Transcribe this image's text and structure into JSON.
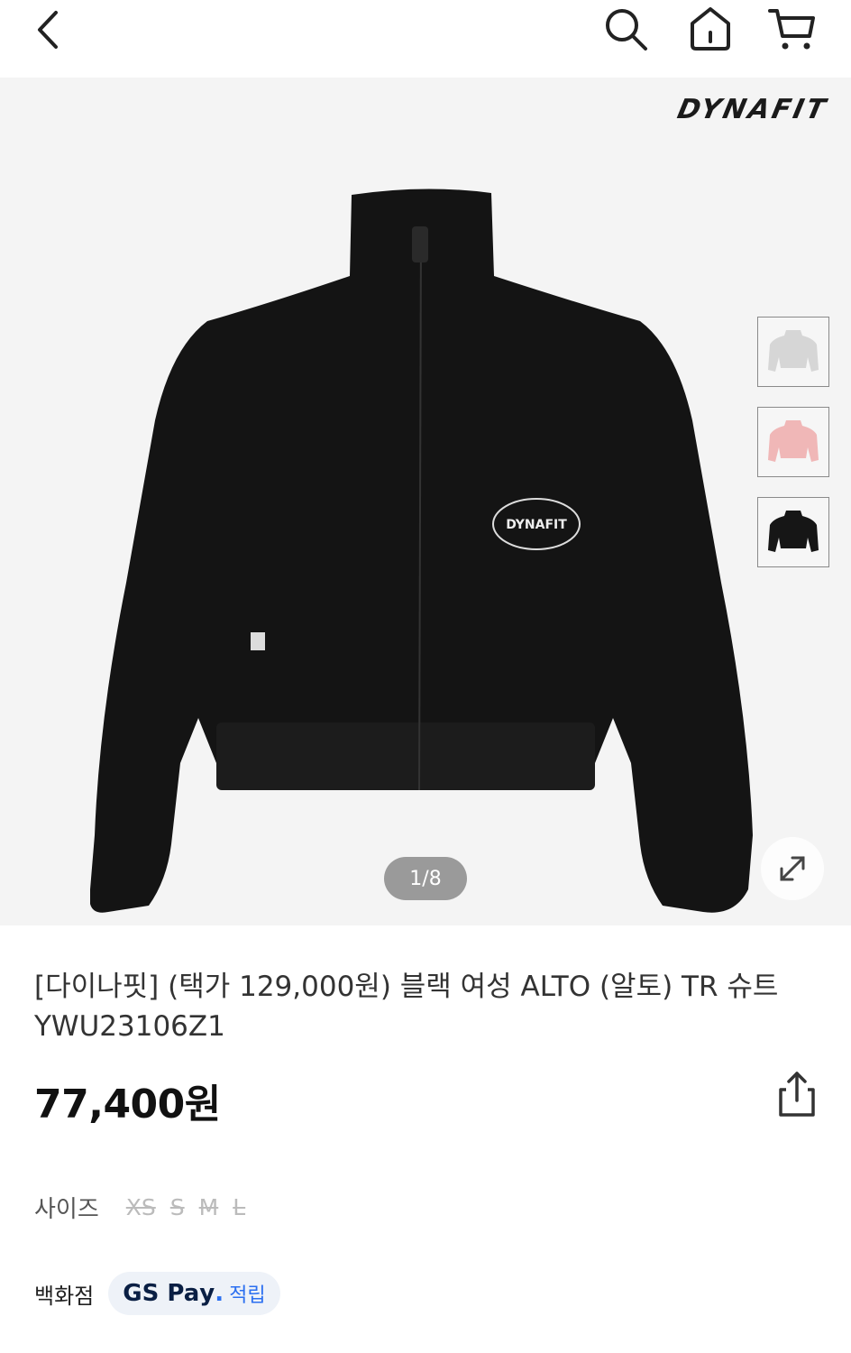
{
  "header": {
    "back_icon": "chevron-left-icon",
    "search_icon": "search-icon",
    "home_icon": "home-icon",
    "cart_icon": "cart-icon"
  },
  "gallery": {
    "brand_logo": "DYNAFIT",
    "pager": "1/8",
    "thumbnails": [
      {
        "color": "light-gray"
      },
      {
        "color": "pink"
      },
      {
        "color": "black"
      }
    ]
  },
  "product": {
    "title": "[다이나핏] (택가 129,000원) 블랙 여성 ALTO (알토) TR 슈트 YWU23106Z1",
    "price": "77,400원"
  },
  "sizes": {
    "label": "사이즈",
    "options": [
      "XS",
      "S",
      "M",
      "L"
    ]
  },
  "department": {
    "label": "백화점",
    "badge_gs": "GS Pa",
    "badge_y": "y",
    "badge_dot": ".",
    "badge_earn": "적립"
  },
  "colors": {
    "accent": "#2b6ff0",
    "pager_bg": "#9a9a9a",
    "gallery_bg": "#f4f4f4"
  }
}
